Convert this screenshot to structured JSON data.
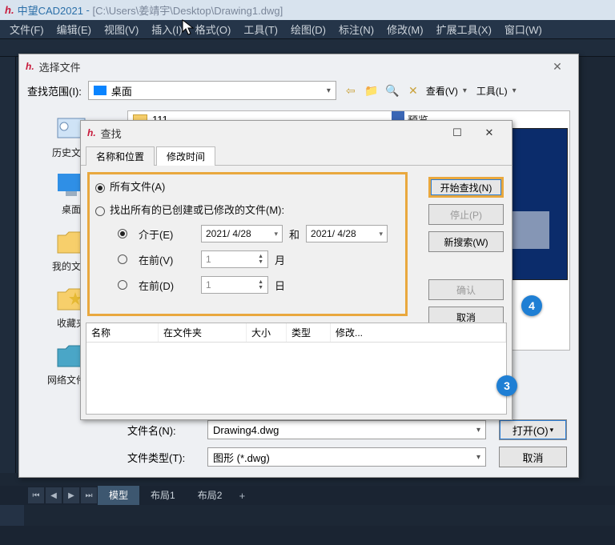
{
  "app": {
    "name": "中望CAD2021",
    "path": "[C:\\Users\\姜靖宇\\Desktop\\Drawing1.dwg]"
  },
  "menu": [
    "文件(F)",
    "编辑(E)",
    "视图(V)",
    "插入(I)",
    "格式(O)",
    "工具(T)",
    "绘图(D)",
    "标注(N)",
    "修改(M)",
    "扩展工具(X)",
    "窗口(W)"
  ],
  "selectdlg": {
    "title": "选择文件",
    "range_label": "查找范围(I):",
    "range_value": "桌面",
    "view_btn": "查看(V)",
    "tools_btn": "工具(L)",
    "list_item": "111",
    "preview_label": "预览",
    "nav": [
      "历史文件",
      "桌面",
      "我的文档",
      "收藏夹",
      "网络文件夹"
    ],
    "filename_label": "文件名(N):",
    "filename_value": "Drawing4.dwg",
    "filetype_label": "文件类型(T):",
    "filetype_value": "图形 (*.dwg)",
    "open_btn": "打开(O)",
    "cancel_btn": "取消"
  },
  "finddlg": {
    "title": "查找",
    "tab1": "名称和位置",
    "tab2": "修改时间",
    "opt_all": "所有文件(A)",
    "opt_modified": "找出所有的已创建或已修改的文件(M):",
    "between_label": "介于(E)",
    "date1": "2021/ 4/28",
    "and": "和",
    "date2": "2021/ 4/28",
    "before_v": "在前(V)",
    "val_v": "1",
    "unit_v": "月",
    "before_d": "在前(D)",
    "val_d": "1",
    "unit_d": "日",
    "start": "开始查找(N)",
    "stop": "停止(P)",
    "new": "新搜索(W)",
    "ok": "确认",
    "cancel": "取消",
    "col_name": "名称",
    "col_folder": "在文件夹",
    "col_size": "大小",
    "col_type": "类型",
    "col_mod": "修改..."
  },
  "badges": {
    "b3": "3",
    "b4": "4"
  },
  "tabs": {
    "model": "模型",
    "l1": "布局1",
    "l2": "布局2"
  }
}
